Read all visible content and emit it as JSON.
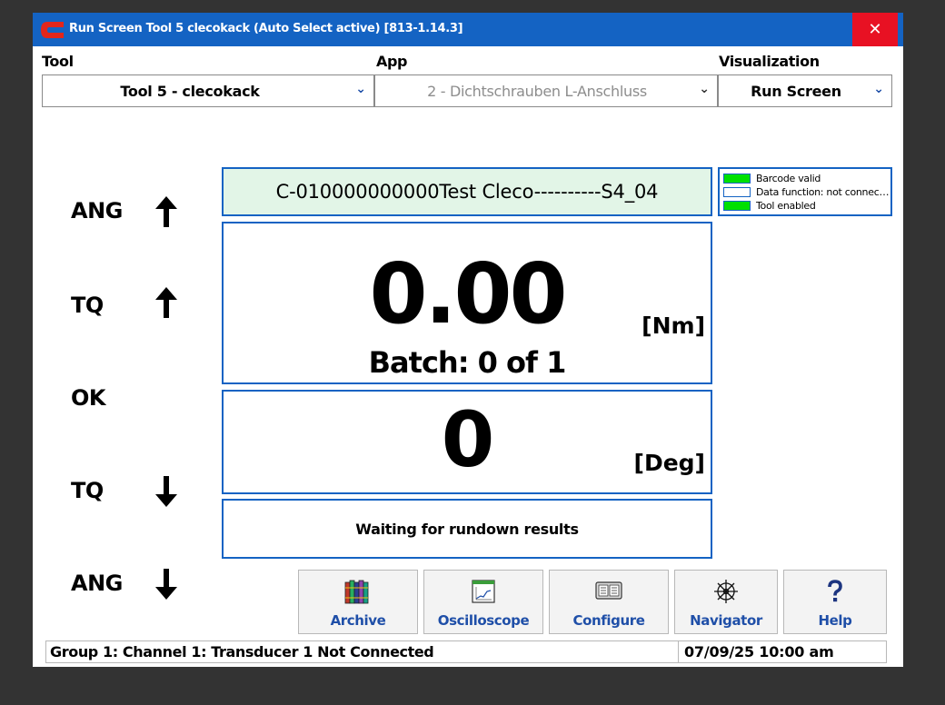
{
  "window": {
    "title": "Run Screen  Tool 5  clecokack  (Auto Select active) [813-1.14.3]",
    "close_label": "✕"
  },
  "selectors": {
    "tool": {
      "label": "Tool",
      "value": "Tool  5 - clecokack"
    },
    "app": {
      "label": "App",
      "value": "2 - Dichtschrauben L-Anschluss"
    },
    "visualization": {
      "label": "Visualization",
      "value": "Run Screen"
    }
  },
  "limits": {
    "ang_high": "ANG",
    "tq_high": "TQ",
    "result": "OK",
    "tq_low": "TQ",
    "ang_low": "ANG"
  },
  "barcode": "C-010000000000Test Cleco----------S4_04",
  "torque": {
    "value": "0.00",
    "unit": "[Nm]"
  },
  "batch": "Batch: 0 of 1",
  "angle": {
    "value": "0",
    "unit": "[Deg]"
  },
  "status_message": "Waiting for rundown results",
  "legend": [
    {
      "label": "Barcode valid",
      "color": "#00e000"
    },
    {
      "label": "Data function: not connected",
      "color": "#ffffff"
    },
    {
      "label": "Tool enabled",
      "color": "#00e000"
    }
  ],
  "toolbar": {
    "archive": {
      "label": "Archive",
      "icon": "books-icon"
    },
    "oscilloscope": {
      "label": "Oscilloscope",
      "icon": "oscilloscope-icon"
    },
    "configure": {
      "label": "Configure",
      "icon": "panel-icon"
    },
    "navigator": {
      "label": "Navigator",
      "icon": "ship-wheel-icon"
    },
    "help": {
      "label": "Help",
      "icon": "question-icon"
    }
  },
  "statusbar": {
    "message": "Group 1: Channel 1: Transducer 1 Not Connected",
    "datetime": "07/09/25 10:00 am"
  },
  "colors": {
    "titlebar": "#1463c3",
    "close": "#e81123",
    "barcode_bg": "#e2f5e7",
    "accent_text": "#1f4fa8"
  }
}
